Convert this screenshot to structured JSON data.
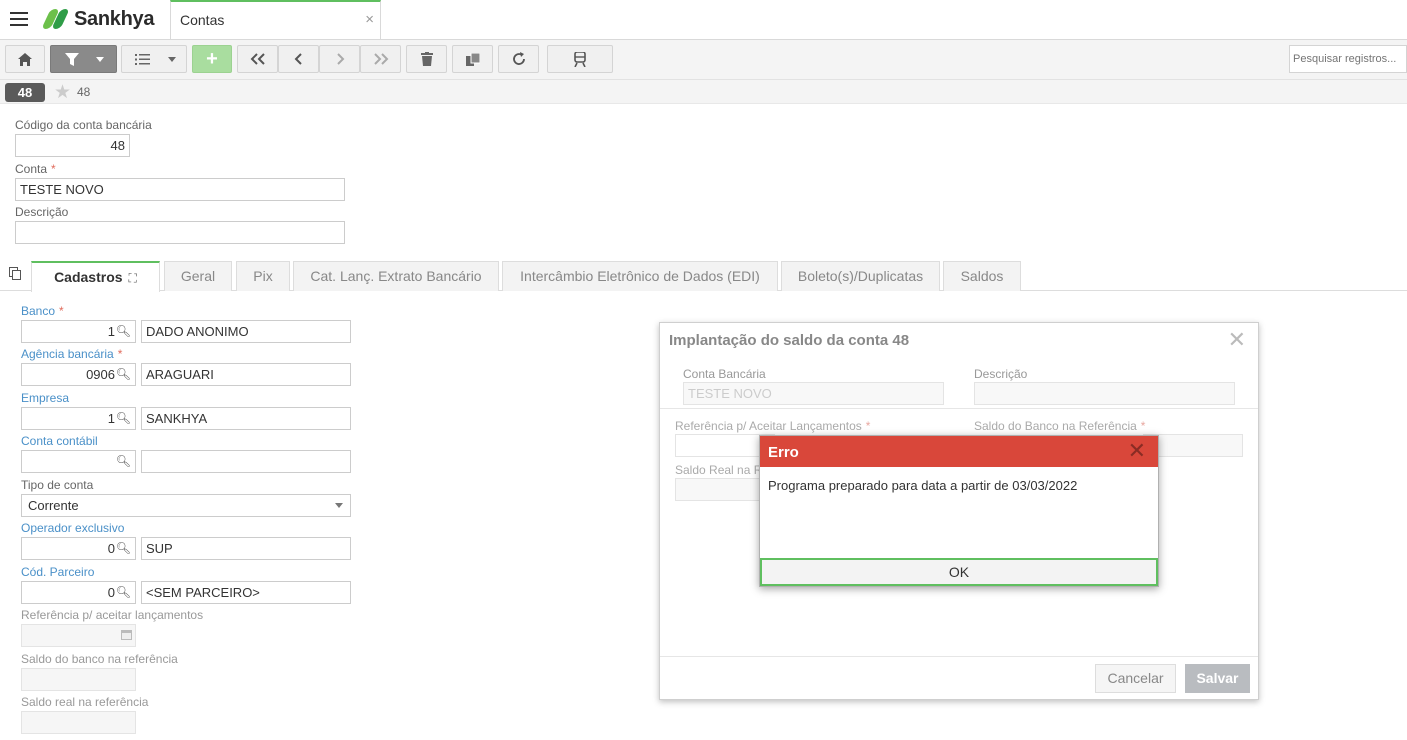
{
  "app": {
    "brand": "Sankhya",
    "tab_title": "Contas",
    "tab_close": "×"
  },
  "toolbar": {
    "add_label": "+",
    "search_placeholder": "Pesquisar registros..."
  },
  "record": {
    "badge": "48",
    "number": "48"
  },
  "form": {
    "codigo_label": "Código da conta bancária",
    "codigo_value": "48",
    "conta_label": "Conta",
    "conta_value": "TESTE NOVO",
    "descricao_label": "Descrição",
    "descricao_value": "",
    "required_mark": "*"
  },
  "tabs": [
    {
      "label": "Cadastros"
    },
    {
      "label": "Geral"
    },
    {
      "label": "Pix"
    },
    {
      "label": "Cat. Lanç. Extrato Bancário"
    },
    {
      "label": "Intercâmbio Eletrônico de Dados (EDI)"
    },
    {
      "label": "Boleto(s)/Duplicatas"
    },
    {
      "label": "Saldos"
    }
  ],
  "cadastros": {
    "banco": {
      "label": "Banco",
      "code": "1",
      "name": "DADO ANONIMO"
    },
    "agencia": {
      "label": "Agência bancária",
      "code": "0906",
      "name": "ARAGUARI"
    },
    "empresa": {
      "label": "Empresa",
      "code": "1",
      "name": "SANKHYA"
    },
    "conta_contabil": {
      "label": "Conta contábil",
      "code": "",
      "name": ""
    },
    "tipo_conta": {
      "label": "Tipo de conta",
      "value": "Corrente"
    },
    "operador": {
      "label": "Operador exclusivo",
      "code": "0",
      "name": "SUP"
    },
    "parceiro": {
      "label": "Cód. Parceiro",
      "code": "0",
      "name": "<SEM PARCEIRO>"
    },
    "referencia_label": "Referência p/ aceitar lançamentos",
    "saldo_banco_label": "Saldo do banco na referência",
    "saldo_real_label": "Saldo real na referência"
  },
  "dialog": {
    "title": "Implantação do saldo da conta 48",
    "conta_bancaria_label": "Conta Bancária",
    "conta_bancaria_value": "TESTE NOVO",
    "descricao_label": "Descrição",
    "referencia_label": "Referência p/ Aceitar Lançamentos",
    "saldo_banco_label": "Saldo do Banco na Referência",
    "saldo_real_label": "Saldo Real na R",
    "cancel_label": "Cancelar",
    "save_label": "Salvar"
  },
  "error": {
    "title": "Erro",
    "message": "Programa preparado para data a partir de 03/03/2022",
    "ok_label": "OK"
  }
}
